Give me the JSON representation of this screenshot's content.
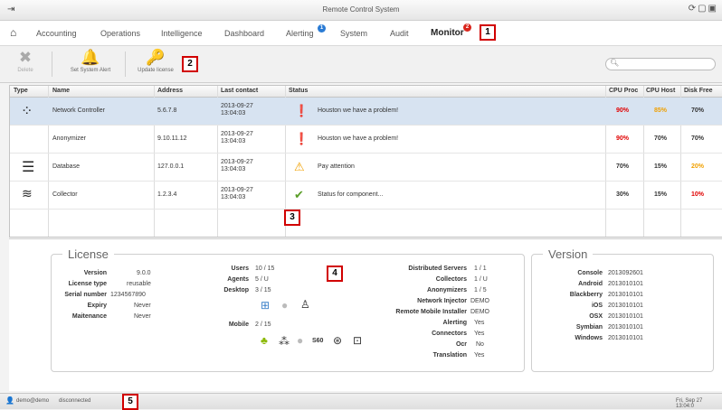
{
  "window": {
    "title": "Remote Control System"
  },
  "nav": {
    "tabs": [
      "Accounting",
      "Operations",
      "Intelligence",
      "Dashboard",
      "Alerting",
      "System",
      "Audit",
      "Monitor"
    ],
    "alerting_badge": "1",
    "monitor_badge": "2",
    "active": "Monitor"
  },
  "toolbar": {
    "delete_label": "Delete",
    "set_alert_label": "Set System Alert",
    "update_license_label": "Update license"
  },
  "search": {
    "placeholder": ""
  },
  "callouts": [
    "1",
    "2",
    "3",
    "4",
    "5"
  ],
  "table": {
    "columns": [
      "Type",
      "Name",
      "Address",
      "Last contact",
      "Status",
      "CPU Proc",
      "CPU Host",
      "Disk Free"
    ],
    "rows": [
      {
        "type_icon": "network-icon",
        "name": "Network Controller",
        "address": "5.6.7.8",
        "contact_date": "2013-09-27",
        "contact_time": "13:04:03",
        "status_icon": "error-icon",
        "status": "Houston we have a problem!",
        "cpu_proc": "90%",
        "cpu_host": "85%",
        "disk_free": "70%",
        "cpu_proc_color": "#e00000",
        "cpu_host_color": "#f0a000",
        "disk_free_color": "#333333",
        "selected": true
      },
      {
        "type_icon": "",
        "name": "Anonymizer",
        "address": "9.10.11.12",
        "contact_date": "2013-09-27",
        "contact_time": "13:04:03",
        "status_icon": "error-icon",
        "status": "Houston we have a problem!",
        "cpu_proc": "90%",
        "cpu_host": "70%",
        "disk_free": "70%",
        "cpu_proc_color": "#e00000",
        "cpu_host_color": "#333333",
        "disk_free_color": "#333333"
      },
      {
        "type_icon": "database-icon",
        "name": "Database",
        "address": "127.0.0.1",
        "contact_date": "2013-09-27",
        "contact_time": "13:04:03",
        "status_icon": "warning-icon",
        "status": "Pay attention",
        "cpu_proc": "70%",
        "cpu_host": "15%",
        "disk_free": "20%",
        "cpu_proc_color": "#333333",
        "cpu_host_color": "#333333",
        "disk_free_color": "#f0a000"
      },
      {
        "type_icon": "wifi-icon",
        "name": "Collector",
        "address": "1.2.3.4",
        "contact_date": "2013-09-27",
        "contact_time": "13:04:03",
        "status_icon": "check-icon",
        "status": "Status for component...",
        "cpu_proc": "30%",
        "cpu_host": "15%",
        "disk_free": "10%",
        "cpu_proc_color": "#333333",
        "cpu_host_color": "#333333",
        "disk_free_color": "#e00000"
      }
    ]
  },
  "license": {
    "title": "License",
    "version_label": "Version",
    "version": "9.0.0",
    "type_label": "License type",
    "type": "reusable",
    "serial_label": "Serial number",
    "serial": "1234567890",
    "expiry_label": "Expiry",
    "expiry": "Never",
    "maintenance_label": "Maitenance",
    "maintenance": "Never",
    "users_label": "Users",
    "users": "10 / 15",
    "agents_label": "Agents",
    "agents": "5 / U",
    "desktop_label": "Desktop",
    "desktop": "3 / 15",
    "mobile_label": "Mobile",
    "mobile": "2 / 15",
    "s60_label": "S60",
    "dist_label": "Distributed Servers",
    "dist": "1 / 1",
    "collectors_label": "Collectors",
    "collectors": "1 / U",
    "anonymizers_label": "Anonymizers",
    "anonymizers": "1 / 5",
    "netinj_label": "Network Injector",
    "netinj": "DEMO",
    "rmi_label": "Remote Mobile Installer",
    "rmi": "DEMO",
    "alerting_label": "Alerting",
    "alerting": "Yes",
    "connectors_label": "Connectors",
    "connectors": "Yes",
    "ocr_label": "Ocr",
    "ocr": "No",
    "translation_label": "Translation",
    "translation": "Yes"
  },
  "version": {
    "title": "Version",
    "items": [
      {
        "label": "Console",
        "value": "2013092601"
      },
      {
        "label": "Android",
        "value": "2013010101"
      },
      {
        "label": "Blackberry",
        "value": "2013010101"
      },
      {
        "label": "iOS",
        "value": "2013010101"
      },
      {
        "label": "OSX",
        "value": "2013010101"
      },
      {
        "label": "Symbian",
        "value": "2013010101"
      },
      {
        "label": "Windows",
        "value": "2013010101"
      }
    ]
  },
  "statusbar": {
    "user": "demo@demo",
    "state": "disconnected",
    "datetime": "Fri, Sep 27 13:04:0"
  }
}
